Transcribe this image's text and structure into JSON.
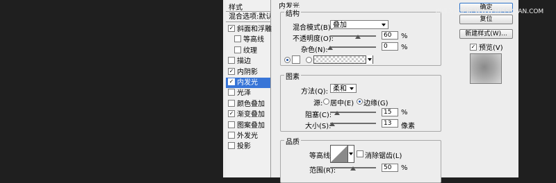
{
  "left_panel": {
    "title": "样式",
    "blend_options": "混合选项:默认",
    "items": [
      {
        "label": "斜面和浮雕",
        "checked": true,
        "indent": false,
        "selected": false
      },
      {
        "label": "等高线",
        "checked": false,
        "indent": true,
        "selected": false
      },
      {
        "label": "纹理",
        "checked": false,
        "indent": true,
        "selected": false
      },
      {
        "label": "描边",
        "checked": false,
        "indent": false,
        "selected": false
      },
      {
        "label": "内阴影",
        "checked": true,
        "indent": false,
        "selected": false
      },
      {
        "label": "内发光",
        "checked": true,
        "indent": false,
        "selected": true
      },
      {
        "label": "光泽",
        "checked": false,
        "indent": false,
        "selected": false
      },
      {
        "label": "颜色叠加",
        "checked": false,
        "indent": false,
        "selected": false
      },
      {
        "label": "渐变叠加",
        "checked": true,
        "indent": false,
        "selected": false
      },
      {
        "label": "图案叠加",
        "checked": false,
        "indent": false,
        "selected": false
      },
      {
        "label": "外发光",
        "checked": false,
        "indent": false,
        "selected": false
      },
      {
        "label": "投影",
        "checked": false,
        "indent": false,
        "selected": false
      }
    ]
  },
  "inner_glow": {
    "title": "内发光",
    "structure": {
      "title": "结构",
      "blend_mode_label": "混合模式(B):",
      "blend_mode_value": "叠加",
      "opacity_label": "不透明度(O):",
      "opacity_value": "60",
      "opacity_fraction": 0.6,
      "noise_label": "杂色(N):",
      "noise_value": "0",
      "noise_fraction": 0,
      "percent": "%"
    },
    "elements": {
      "title": "图素",
      "method_label": "方法(Q):",
      "method_value": "柔和",
      "source_label": "源:",
      "source_center": "居中(E)",
      "source_edge": "边缘(G)",
      "choke_label": "阻塞(C):",
      "choke_value": "15",
      "choke_fraction": 0.15,
      "size_label": "大小(S):",
      "size_value": "13",
      "size_fraction": 0.052,
      "percent": "%",
      "px_unit": "像素"
    },
    "quality": {
      "title": "品质",
      "contour_label": "等高线:",
      "antialias_label": "消除锯齿(L)",
      "range_label": "范围(R):",
      "range_value": "50",
      "range_fraction": 0.5,
      "percent": "%"
    }
  },
  "buttons": {
    "ok": "确定",
    "reset": "复位",
    "new_style": "新建样式(W)...",
    "preview_label": "预览(V)",
    "preview_checked": true
  },
  "watermark": "思缘设计论坛 WWW.MISSYUAN.COM",
  "colors": {
    "selection": "#3875d7",
    "dialog_bg": "#ededed",
    "outer_bg": "#1f1f1f"
  }
}
